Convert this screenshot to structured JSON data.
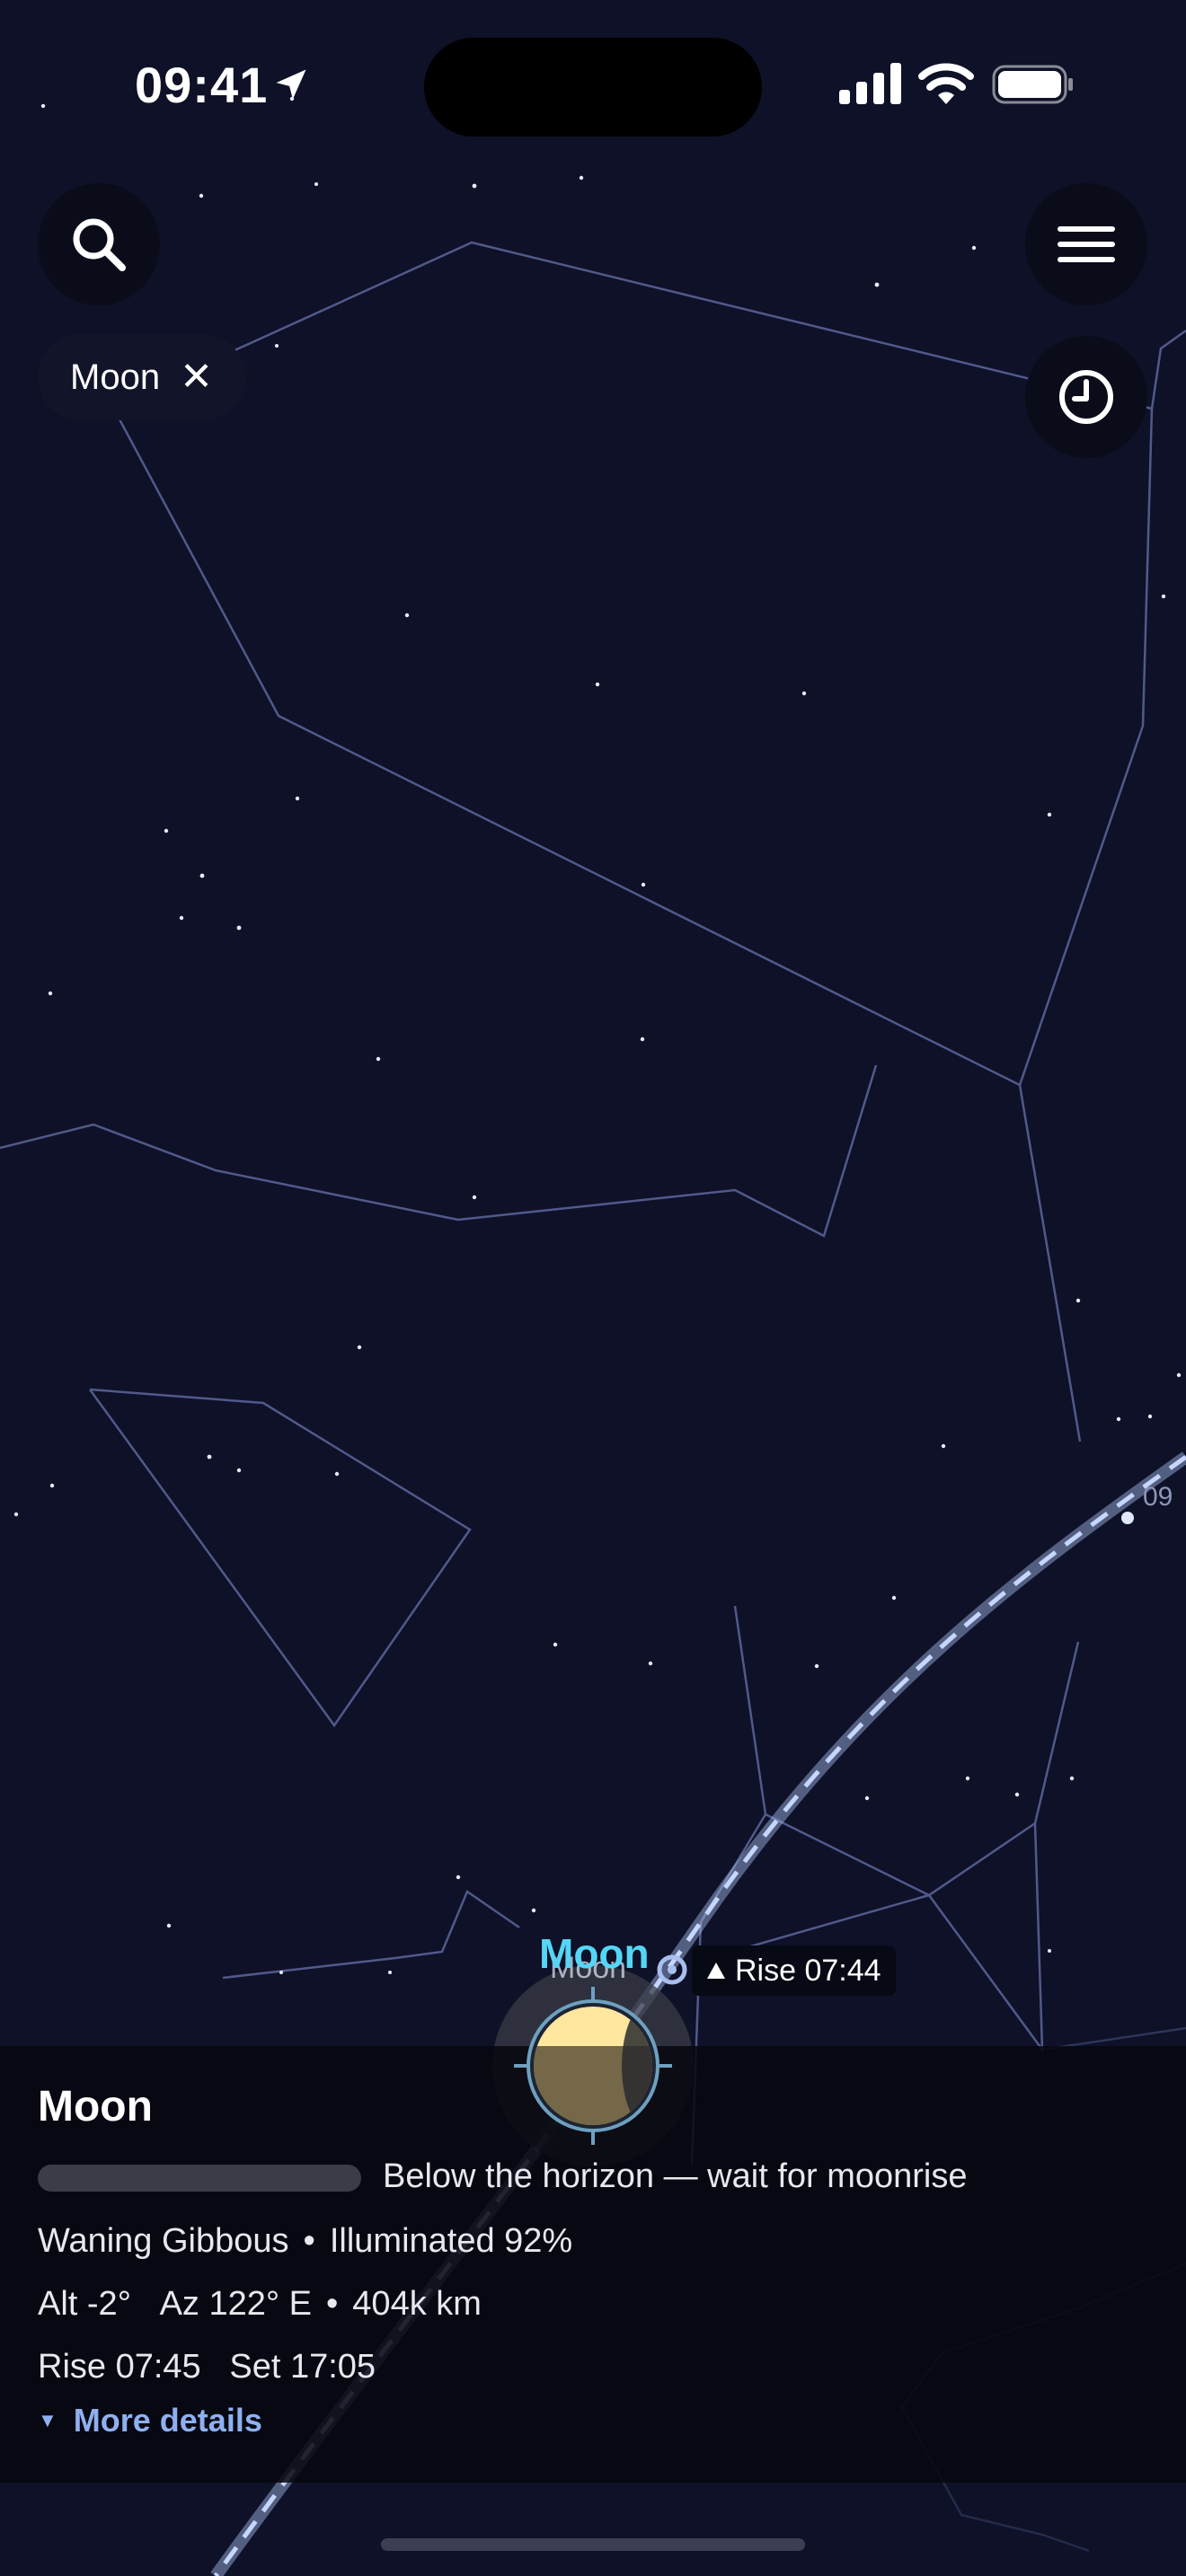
{
  "status_bar": {
    "time": "09:41"
  },
  "chip": {
    "label": "Moon",
    "close_glyph": "✕"
  },
  "icons": {
    "search": "search-icon",
    "menu": "hamburger-menu-icon",
    "history": "clock-icon",
    "location": "location-arrow-icon"
  },
  "sky": {
    "moon_label": "Moon",
    "moon_label_echo": "Moon",
    "rise_tag": "Rise 07:44",
    "edge_label": "09"
  },
  "panel": {
    "title": "Moon",
    "visibility_status": "Below the horizon — wait for moonrise",
    "phase": "Waning Gibbous",
    "illumination": "Illuminated 92%",
    "altitude": "Alt -2°",
    "azimuth": "Az 122° E",
    "distance": "404k km",
    "rise": "Rise 07:45",
    "set": "Set 17:05",
    "more_details": "More details",
    "separator": "•"
  },
  "colors": {
    "sky_background": "#0e1127",
    "constellation_line": "#5a6397",
    "moon_label": "#55d6f5",
    "moon_lit": "#ffe7a0",
    "path_line": "#a9bff0",
    "link": "#8fb0f0"
  }
}
